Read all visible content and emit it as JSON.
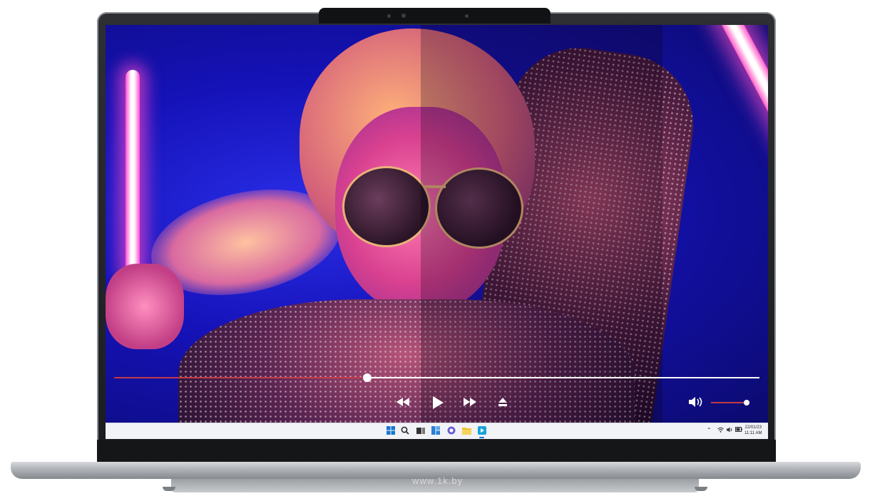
{
  "player": {
    "progress": 0.392,
    "volume": 1.0,
    "controls": {
      "rewind_icon": "rewind-icon",
      "play_icon": "play-icon",
      "fast_forward_icon": "fast-forward-icon",
      "eject_icon": "eject-icon",
      "volume_icon": "speaker-icon"
    }
  },
  "taskbar": {
    "apps": [
      "windows-start-icon",
      "search-icon",
      "task-view-icon",
      "widgets-icon",
      "chat-icon",
      "file-explorer-icon",
      "media-player-icon"
    ],
    "clock": {
      "date": "22/01/23",
      "time": "11:11 AM"
    },
    "tray": [
      "chevron-up-icon",
      "wifi-icon",
      "volume-icon",
      "battery-icon"
    ]
  },
  "watermark": "www.1k.by",
  "colors": {
    "accent": "#c23a48",
    "taskbar_bg": "#f1f3f7"
  }
}
